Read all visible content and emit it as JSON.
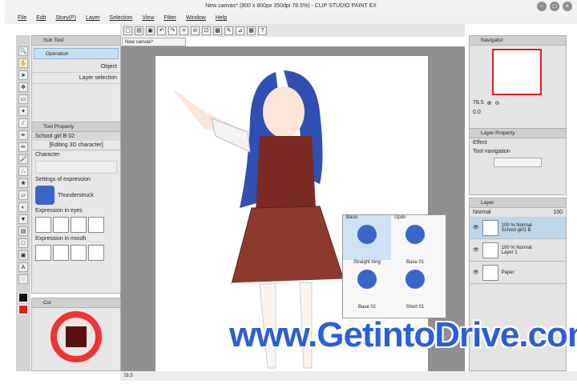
{
  "window": {
    "title": "New canvas* (800 x 800px 350dpi 78.5%) - CLIP STUDIO PAINT EX"
  },
  "menu": [
    "File",
    "Edit",
    "Story(P)",
    "Layer",
    "Selection",
    "View",
    "Filter",
    "Window",
    "Help"
  ],
  "canvas_tab": "New canvas*",
  "sub_tool": {
    "header": "Sub Tool",
    "operation": "Operation",
    "object": "Object",
    "layer_selection": "Layer selection"
  },
  "tool_property": {
    "header": "Tool Property",
    "character_name": "School girl B 02",
    "editing": "[Editing 3D character]",
    "character": "Character",
    "expression_settings": "Settings of expression",
    "expression_name": "Thunderstruck",
    "eyes": "Expression in eyes",
    "mouth": "Expression in mouth"
  },
  "color_panel": {
    "tab": "Col"
  },
  "navigator": {
    "header": "Navigator",
    "zoom": "78.5",
    "angle": "0.0"
  },
  "layer_property": {
    "header": "Layer Property",
    "effect": "Effect",
    "tool_navigation": "Tool navigation"
  },
  "layer_panel": {
    "header": "Layer",
    "blend": "Normal",
    "opacity": "100",
    "layers": [
      {
        "pct": "100 % Normal",
        "name": "School girl1 B"
      },
      {
        "pct": "100 % Normal",
        "name": "Layer 1"
      },
      {
        "pct": "",
        "name": "Paper"
      }
    ]
  },
  "popup": {
    "items": [
      "Basic",
      "Updo",
      "Straight long",
      "Base 01",
      "Base 02",
      "Short 01"
    ]
  },
  "status": {
    "zoom": "78.5"
  },
  "watermark": "www.GetintoDrive.com",
  "colors": {
    "accent": "#2b5fd8",
    "ui_gray": "#d9d9d9"
  }
}
